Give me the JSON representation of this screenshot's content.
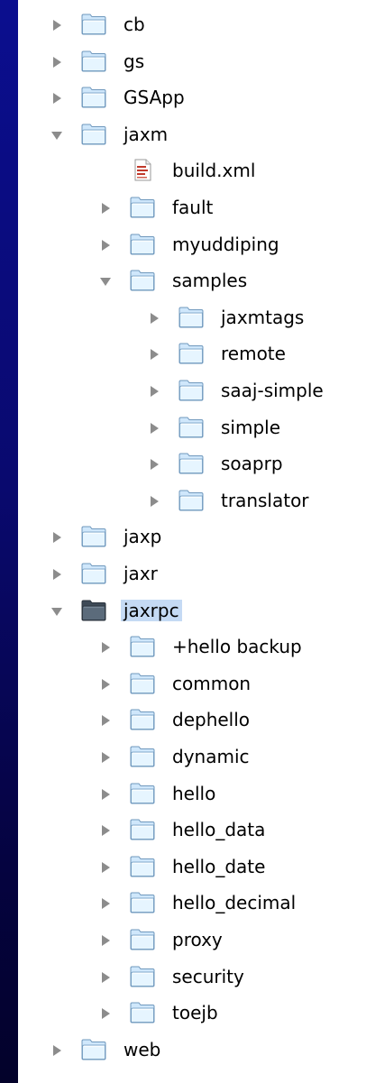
{
  "tree": {
    "rows": [
      {
        "label": "cb",
        "depth": 0,
        "state": "collapsed",
        "kind": "folder"
      },
      {
        "label": "gs",
        "depth": 0,
        "state": "collapsed",
        "kind": "folder"
      },
      {
        "label": "GSApp",
        "depth": 0,
        "state": "collapsed",
        "kind": "folder"
      },
      {
        "label": "jaxm",
        "depth": 0,
        "state": "expanded",
        "kind": "folder"
      },
      {
        "label": "build.xml",
        "depth": 1,
        "state": "leaf",
        "kind": "file"
      },
      {
        "label": "fault",
        "depth": 1,
        "state": "collapsed",
        "kind": "folder"
      },
      {
        "label": "myuddiping",
        "depth": 1,
        "state": "collapsed",
        "kind": "folder"
      },
      {
        "label": "samples",
        "depth": 1,
        "state": "expanded",
        "kind": "folder"
      },
      {
        "label": "jaxmtags",
        "depth": 2,
        "state": "collapsed",
        "kind": "folder"
      },
      {
        "label": "remote",
        "depth": 2,
        "state": "collapsed",
        "kind": "folder"
      },
      {
        "label": "saaj-simple",
        "depth": 2,
        "state": "collapsed",
        "kind": "folder"
      },
      {
        "label": "simple",
        "depth": 2,
        "state": "collapsed",
        "kind": "folder"
      },
      {
        "label": "soaprp",
        "depth": 2,
        "state": "collapsed",
        "kind": "folder"
      },
      {
        "label": "translator",
        "depth": 2,
        "state": "collapsed",
        "kind": "folder"
      },
      {
        "label": "jaxp",
        "depth": 0,
        "state": "collapsed",
        "kind": "folder"
      },
      {
        "label": "jaxr",
        "depth": 0,
        "state": "collapsed",
        "kind": "folder"
      },
      {
        "label": "jaxrpc",
        "depth": 0,
        "state": "expanded",
        "kind": "folder",
        "selected": true
      },
      {
        "label": "+hello backup",
        "depth": 1,
        "state": "collapsed",
        "kind": "folder"
      },
      {
        "label": "common",
        "depth": 1,
        "state": "collapsed",
        "kind": "folder"
      },
      {
        "label": "dephello",
        "depth": 1,
        "state": "collapsed",
        "kind": "folder"
      },
      {
        "label": "dynamic",
        "depth": 1,
        "state": "collapsed",
        "kind": "folder"
      },
      {
        "label": "hello",
        "depth": 1,
        "state": "collapsed",
        "kind": "folder"
      },
      {
        "label": "hello_data",
        "depth": 1,
        "state": "collapsed",
        "kind": "folder"
      },
      {
        "label": "hello_date",
        "depth": 1,
        "state": "collapsed",
        "kind": "folder"
      },
      {
        "label": "hello_decimal",
        "depth": 1,
        "state": "collapsed",
        "kind": "folder"
      },
      {
        "label": "proxy",
        "depth": 1,
        "state": "collapsed",
        "kind": "folder"
      },
      {
        "label": "security",
        "depth": 1,
        "state": "collapsed",
        "kind": "folder"
      },
      {
        "label": "toejb",
        "depth": 1,
        "state": "collapsed",
        "kind": "folder"
      },
      {
        "label": "web",
        "depth": 0,
        "state": "collapsed",
        "kind": "folder"
      }
    ]
  },
  "colors": {
    "background_gradient_top": "#0b0e8f",
    "background_gradient_bottom": "#03022a",
    "selection": "#c5daf4",
    "triangle": "#8c8c8c",
    "folder_light": "#d9efff",
    "folder_dark": "#53708a"
  },
  "icons": {
    "folder": "folder-icon",
    "file": "xml-file-icon",
    "collapsed": "disclosure-triangle-right-icon",
    "expanded": "disclosure-triangle-down-icon"
  }
}
